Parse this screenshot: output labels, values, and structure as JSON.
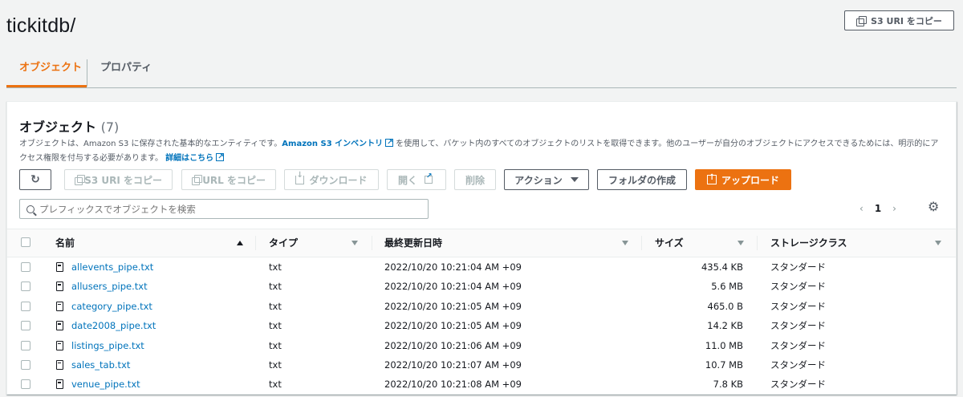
{
  "header": {
    "title": "tickitdb/",
    "copy_s3_uri": "S3 URI をコピー"
  },
  "tabs": [
    {
      "label": "オブジェクト",
      "active": true
    },
    {
      "label": "プロパティ",
      "active": false
    }
  ],
  "panel": {
    "title": "オブジェクト",
    "count": "(7)",
    "desc_1": "オブジェクトは、Amazon S3 に保存された基本的なエンティティです。",
    "desc_link_1": "Amazon S3 インベントリ",
    "desc_2": "を使用して、バケット内のすべてのオブジェクトのリストを取得できます。他のユーザーが自分のオブジェクトにアクセスできるためには、明示的にアクセス権限を付与する必要があります。",
    "desc_link_2": "詳細はこちら"
  },
  "toolbar": {
    "copy_s3_uri": "S3 URI をコピー",
    "copy_url": "URL をコピー",
    "download": "ダウンロード",
    "open": "開く",
    "delete": "削除",
    "actions": "アクション",
    "create_folder": "フォルダの作成",
    "upload": "アップロード"
  },
  "search": {
    "placeholder": "プレフィックスでオブジェクトを検索"
  },
  "pager": {
    "page": "1"
  },
  "table": {
    "columns": [
      "名前",
      "タイプ",
      "最終更新日時",
      "サイズ",
      "ストレージクラス"
    ],
    "rows": [
      {
        "name": "allevents_pipe.txt",
        "type": "txt",
        "modified": "2022/10/20 10:21:04 AM +09",
        "size": "435.4 KB",
        "storage": "スタンダード"
      },
      {
        "name": "allusers_pipe.txt",
        "type": "txt",
        "modified": "2022/10/20 10:21:04 AM +09",
        "size": "5.6 MB",
        "storage": "スタンダード"
      },
      {
        "name": "category_pipe.txt",
        "type": "txt",
        "modified": "2022/10/20 10:21:05 AM +09",
        "size": "465.0 B",
        "storage": "スタンダード"
      },
      {
        "name": "date2008_pipe.txt",
        "type": "txt",
        "modified": "2022/10/20 10:21:05 AM +09",
        "size": "14.2 KB",
        "storage": "スタンダード"
      },
      {
        "name": "listings_pipe.txt",
        "type": "txt",
        "modified": "2022/10/20 10:21:06 AM +09",
        "size": "11.0 MB",
        "storage": "スタンダード"
      },
      {
        "name": "sales_tab.txt",
        "type": "txt",
        "modified": "2022/10/20 10:21:07 AM +09",
        "size": "10.7 MB",
        "storage": "スタンダード"
      },
      {
        "name": "venue_pipe.txt",
        "type": "txt",
        "modified": "2022/10/20 10:21:08 AM +09",
        "size": "7.8 KB",
        "storage": "スタンダード"
      }
    ]
  },
  "colors": {
    "accent": "#ec7211",
    "link": "#0073bb",
    "text": "#16191f"
  }
}
